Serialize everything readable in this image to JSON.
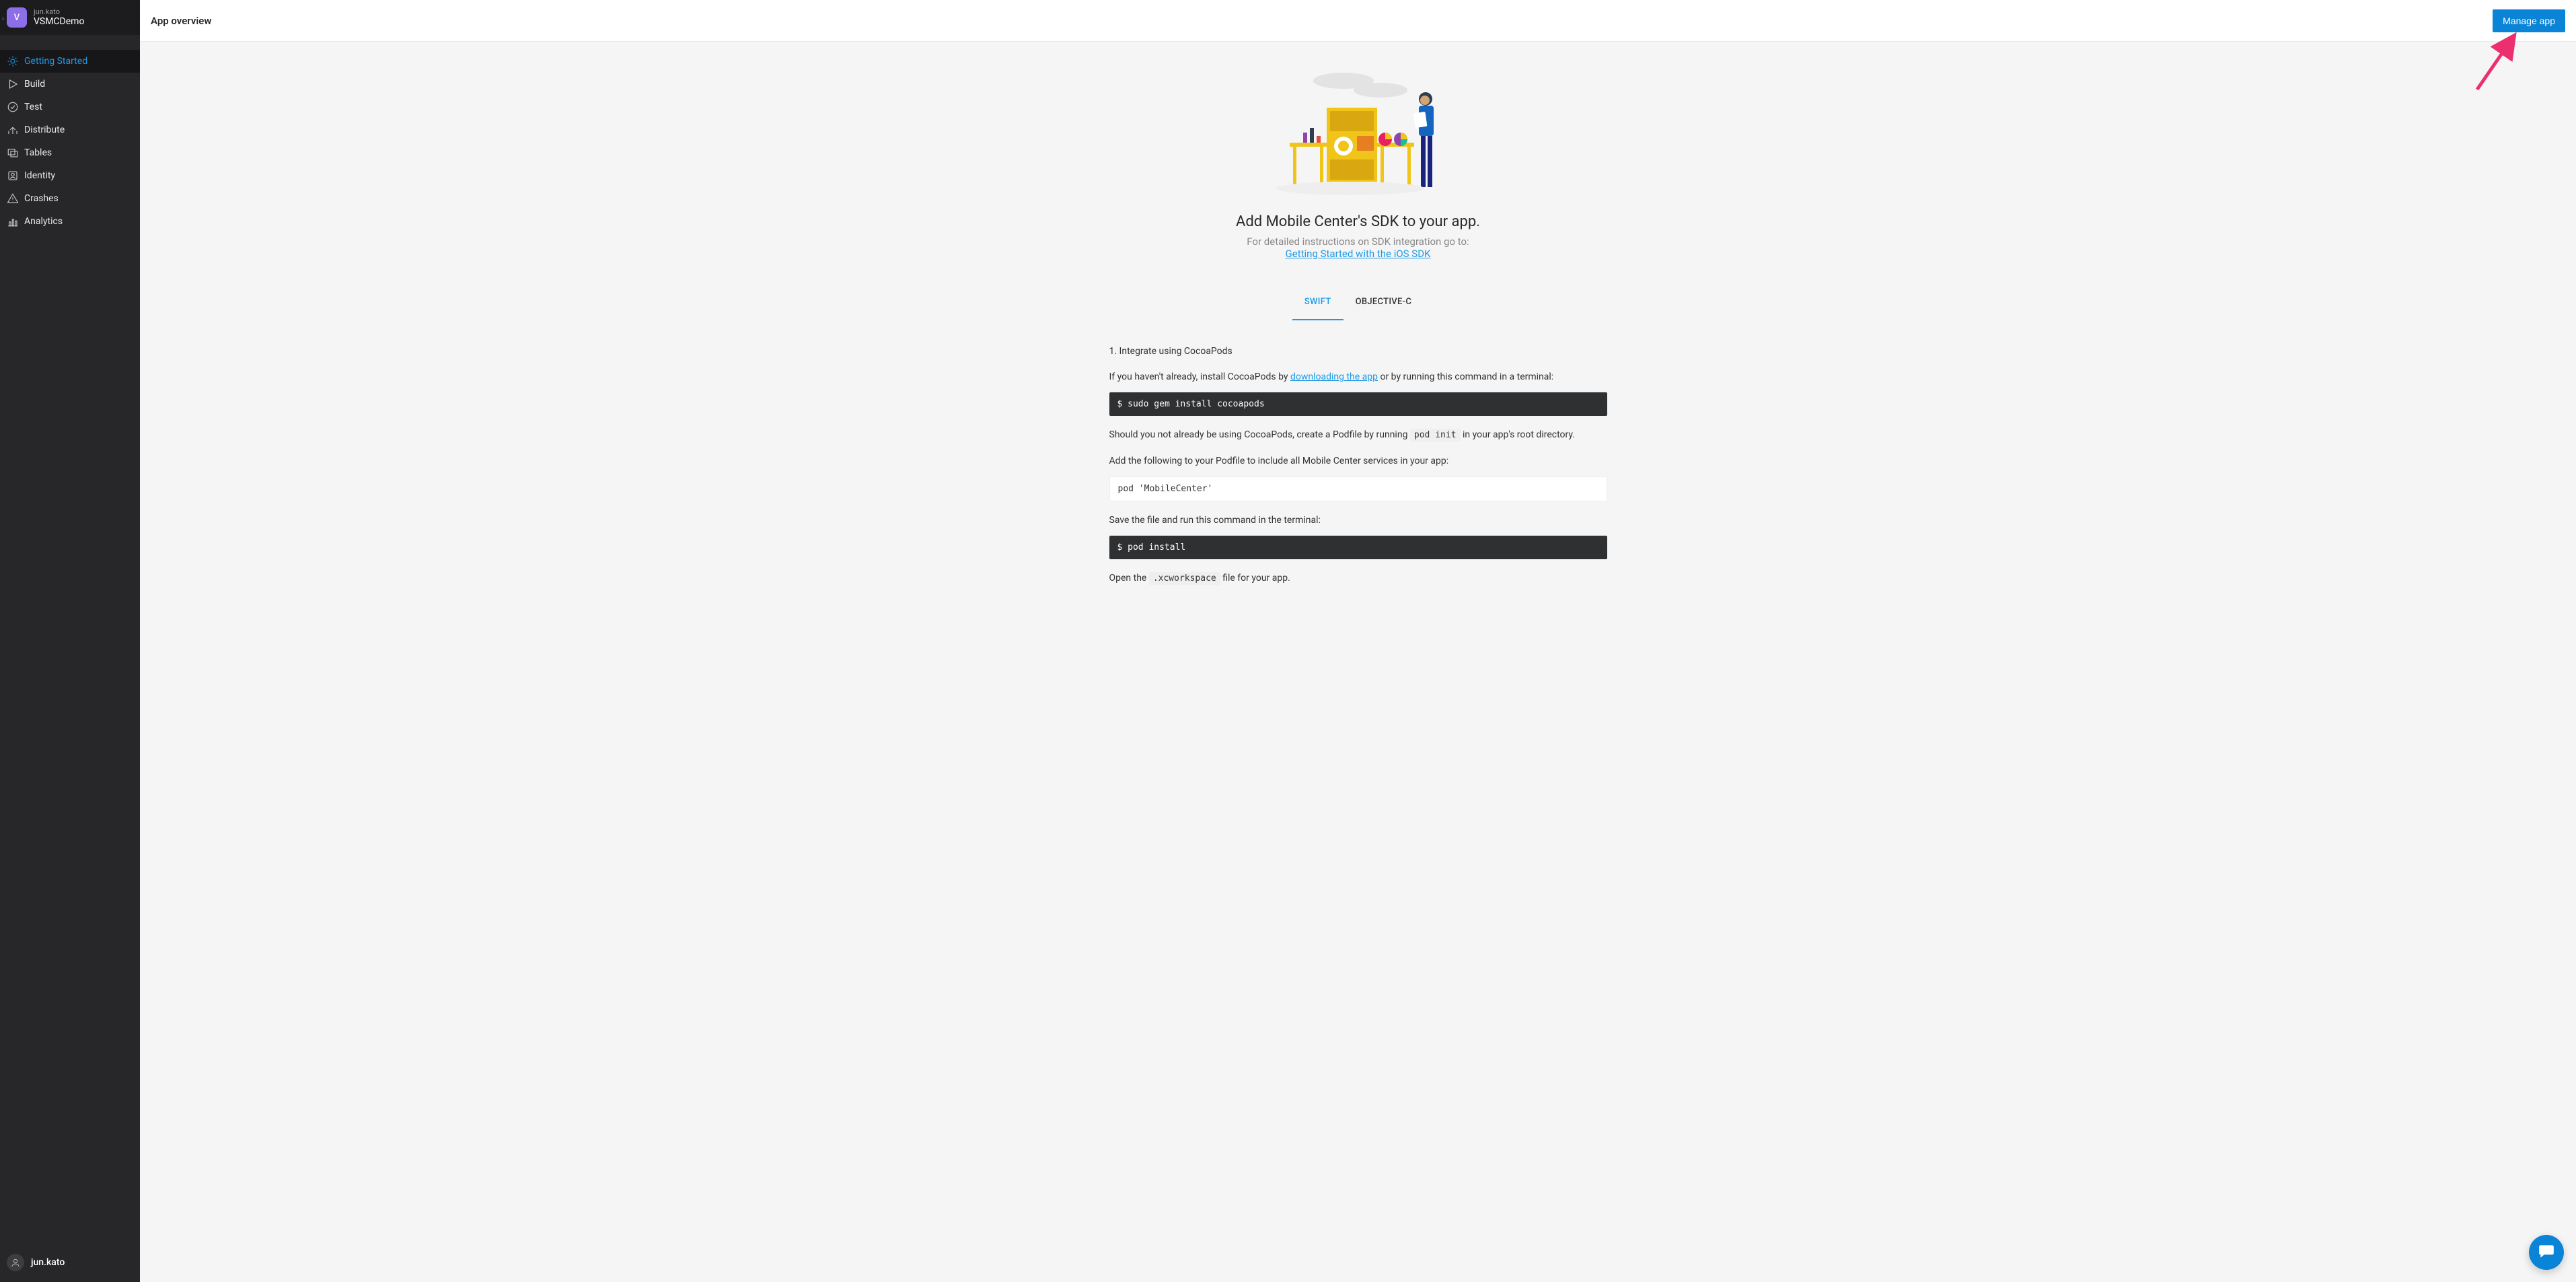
{
  "header": {
    "back_chevron": "‹",
    "app_icon_letter": "V",
    "owner": "jun.kato",
    "app_name": "VSMCDemo"
  },
  "sidebar": {
    "items": [
      {
        "label": "Getting Started",
        "icon": "sun-icon",
        "active": true
      },
      {
        "label": "Build",
        "icon": "play-icon",
        "active": false
      },
      {
        "label": "Test",
        "icon": "check-circle-icon",
        "active": false
      },
      {
        "label": "Distribute",
        "icon": "distribute-icon",
        "active": false
      },
      {
        "label": "Tables",
        "icon": "tables-icon",
        "active": false
      },
      {
        "label": "Identity",
        "icon": "identity-icon",
        "active": false
      },
      {
        "label": "Crashes",
        "icon": "warning-icon",
        "active": false
      },
      {
        "label": "Analytics",
        "icon": "analytics-icon",
        "active": false
      }
    ]
  },
  "footer_user": {
    "name": "jun.kato"
  },
  "topbar": {
    "title": "App overview",
    "manage_button": "Manage app"
  },
  "hero": {
    "heading": "Add Mobile Center's SDK to your app.",
    "subtitle_prefix": "For detailed instructions on SDK integration go to:",
    "subtitle_link": "Getting Started with the iOS SDK"
  },
  "tabs": [
    {
      "label": "SWIFT",
      "active": true
    },
    {
      "label": "OBJECTIVE-C",
      "active": false
    }
  ],
  "steps": {
    "step1_heading": "1. Integrate using CocoaPods",
    "p1_before": "If you haven't already, install CocoaPods by ",
    "p1_link": "downloading the app",
    "p1_after": " or by running this command in a terminal:",
    "cmd1": "$ sudo gem install cocoapods",
    "p2_before": "Should you not already be using CocoaPods, create a Podfile by running ",
    "p2_code": "pod init",
    "p2_after": " in your app's root directory.",
    "p3": "Add the following to your Podfile to include all Mobile Center services in your app:",
    "pod_line": "pod 'MobileCenter'",
    "p4": "Save the file and run this command in the terminal:",
    "cmd2": "$ pod install",
    "p5_before": "Open the ",
    "p5_code": ".xcworkspace",
    "p5_after": " file for your app."
  },
  "colors": {
    "accent": "#1c9ae8",
    "button": "#0a84d6",
    "sidebar_bg": "#27272a",
    "arrow": "#ec2f6e"
  }
}
